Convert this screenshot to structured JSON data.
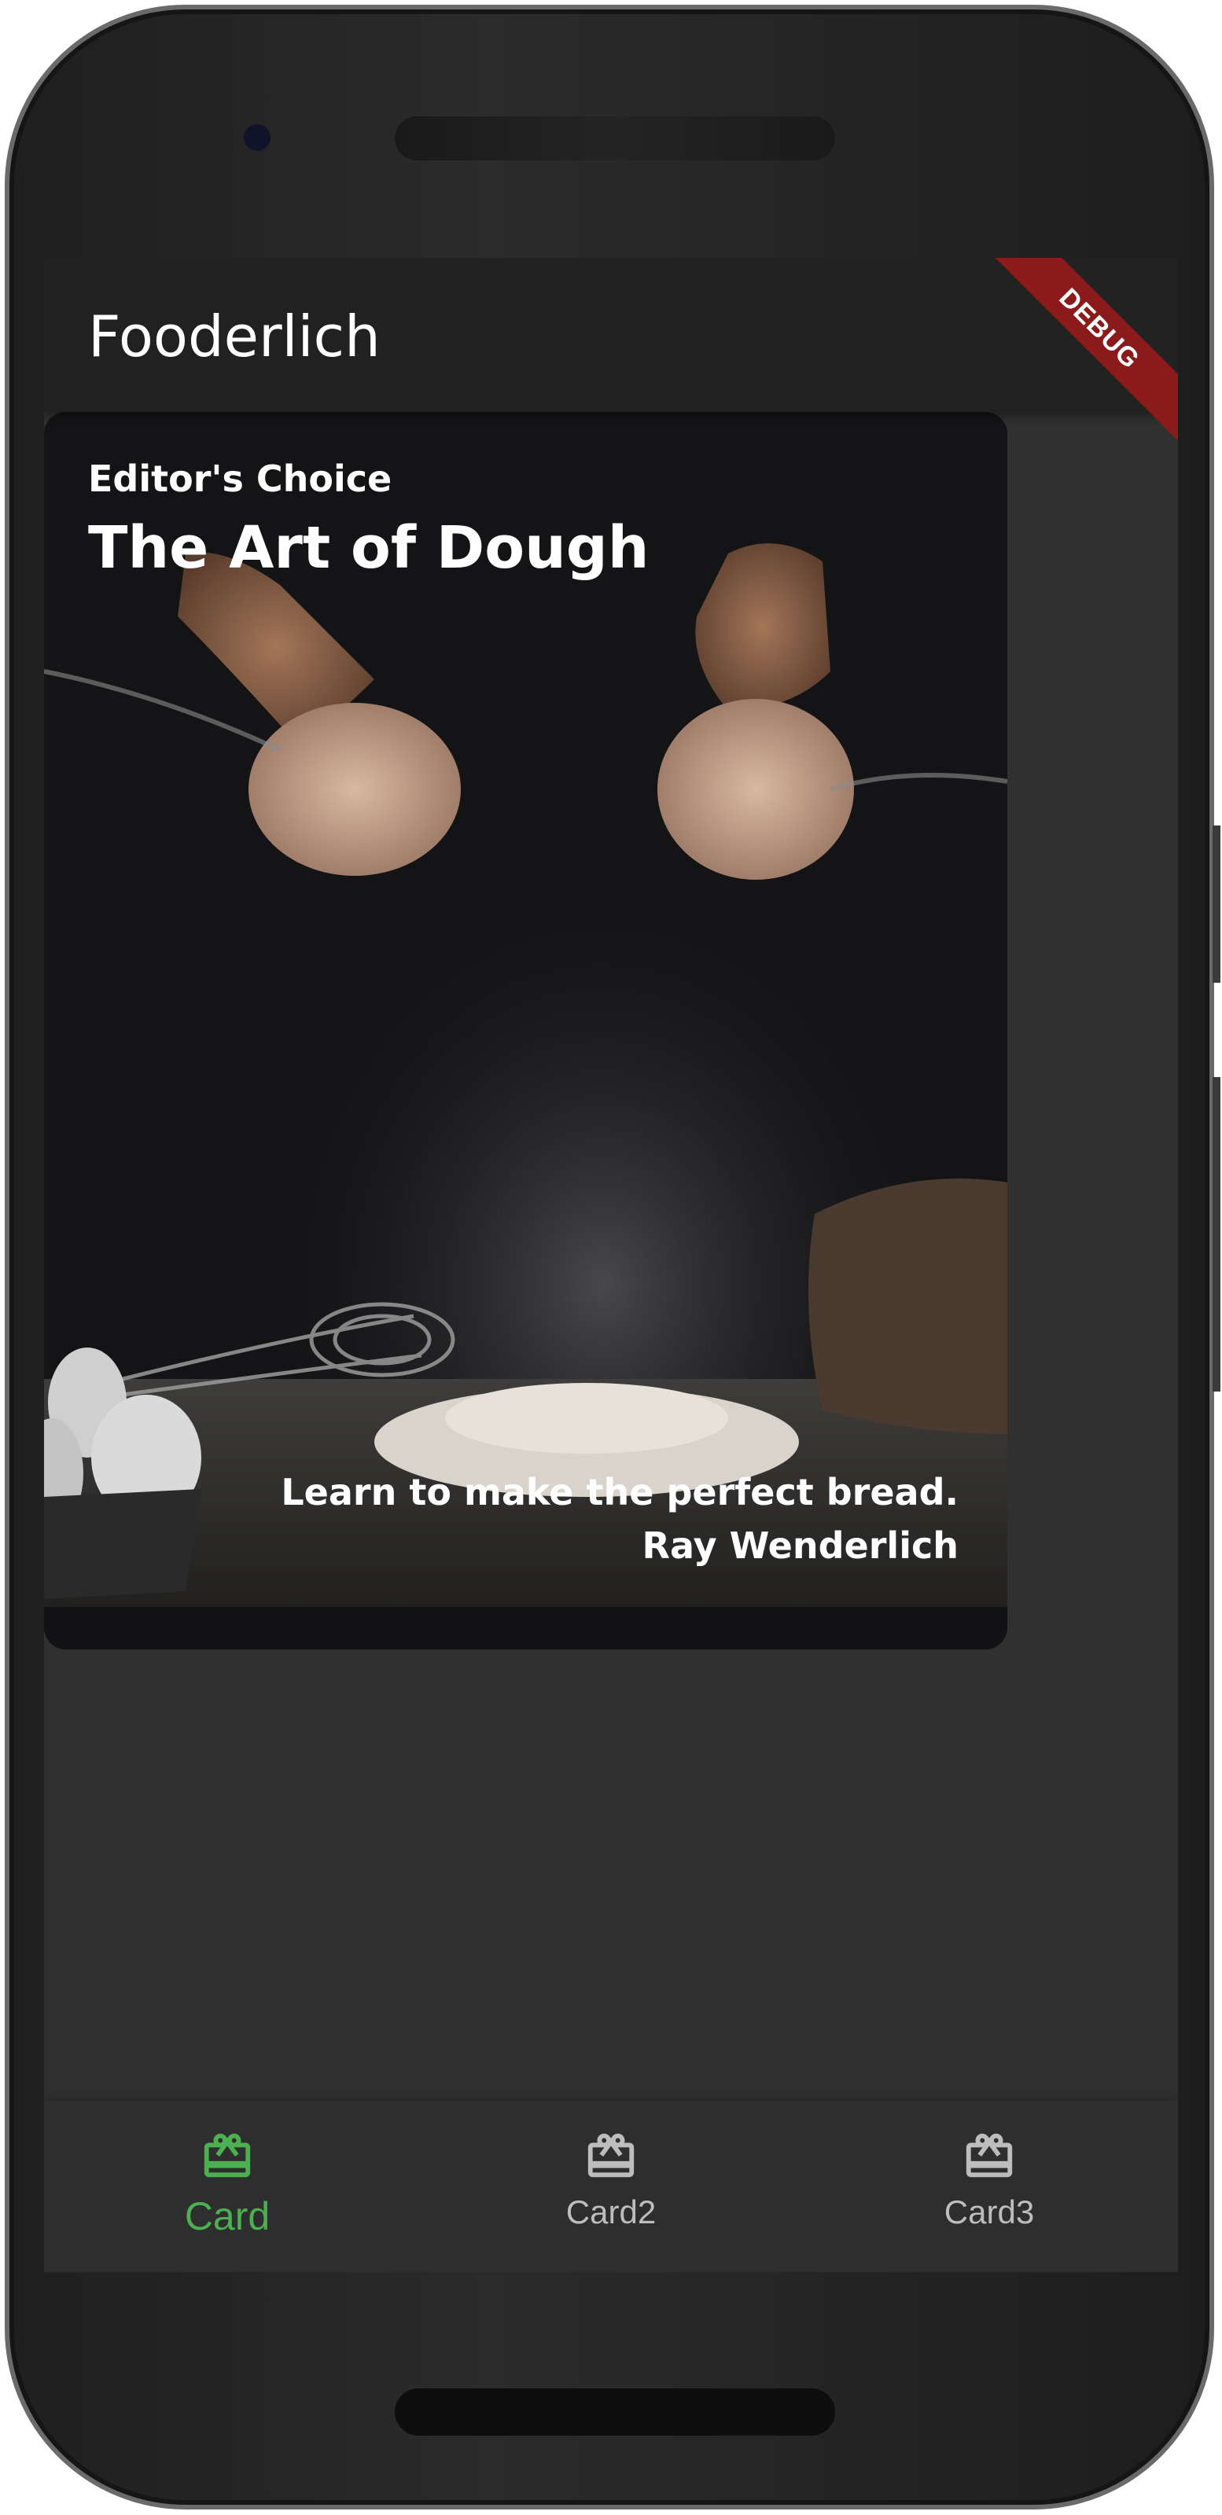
{
  "app_bar": {
    "title": "Fooderlich",
    "debug_banner": "DEBUG"
  },
  "card": {
    "subtitle": "Editor's Choice",
    "title": "The Art of Dough",
    "description": "Learn to make the perfect bread.",
    "author": "Ray Wenderlich"
  },
  "bottom_nav": {
    "items": [
      {
        "label": "Card",
        "icon": "card-giftcard-icon",
        "selected": true
      },
      {
        "label": "Card2",
        "icon": "card-giftcard-icon",
        "selected": false
      },
      {
        "label": "Card3",
        "icon": "card-giftcard-icon",
        "selected": false
      }
    ]
  },
  "colors": {
    "selected": "#4caf50",
    "unselected": "#bdbdbd",
    "app_bar": "#212121",
    "background": "#303030",
    "debug": "#8b1a1a"
  }
}
